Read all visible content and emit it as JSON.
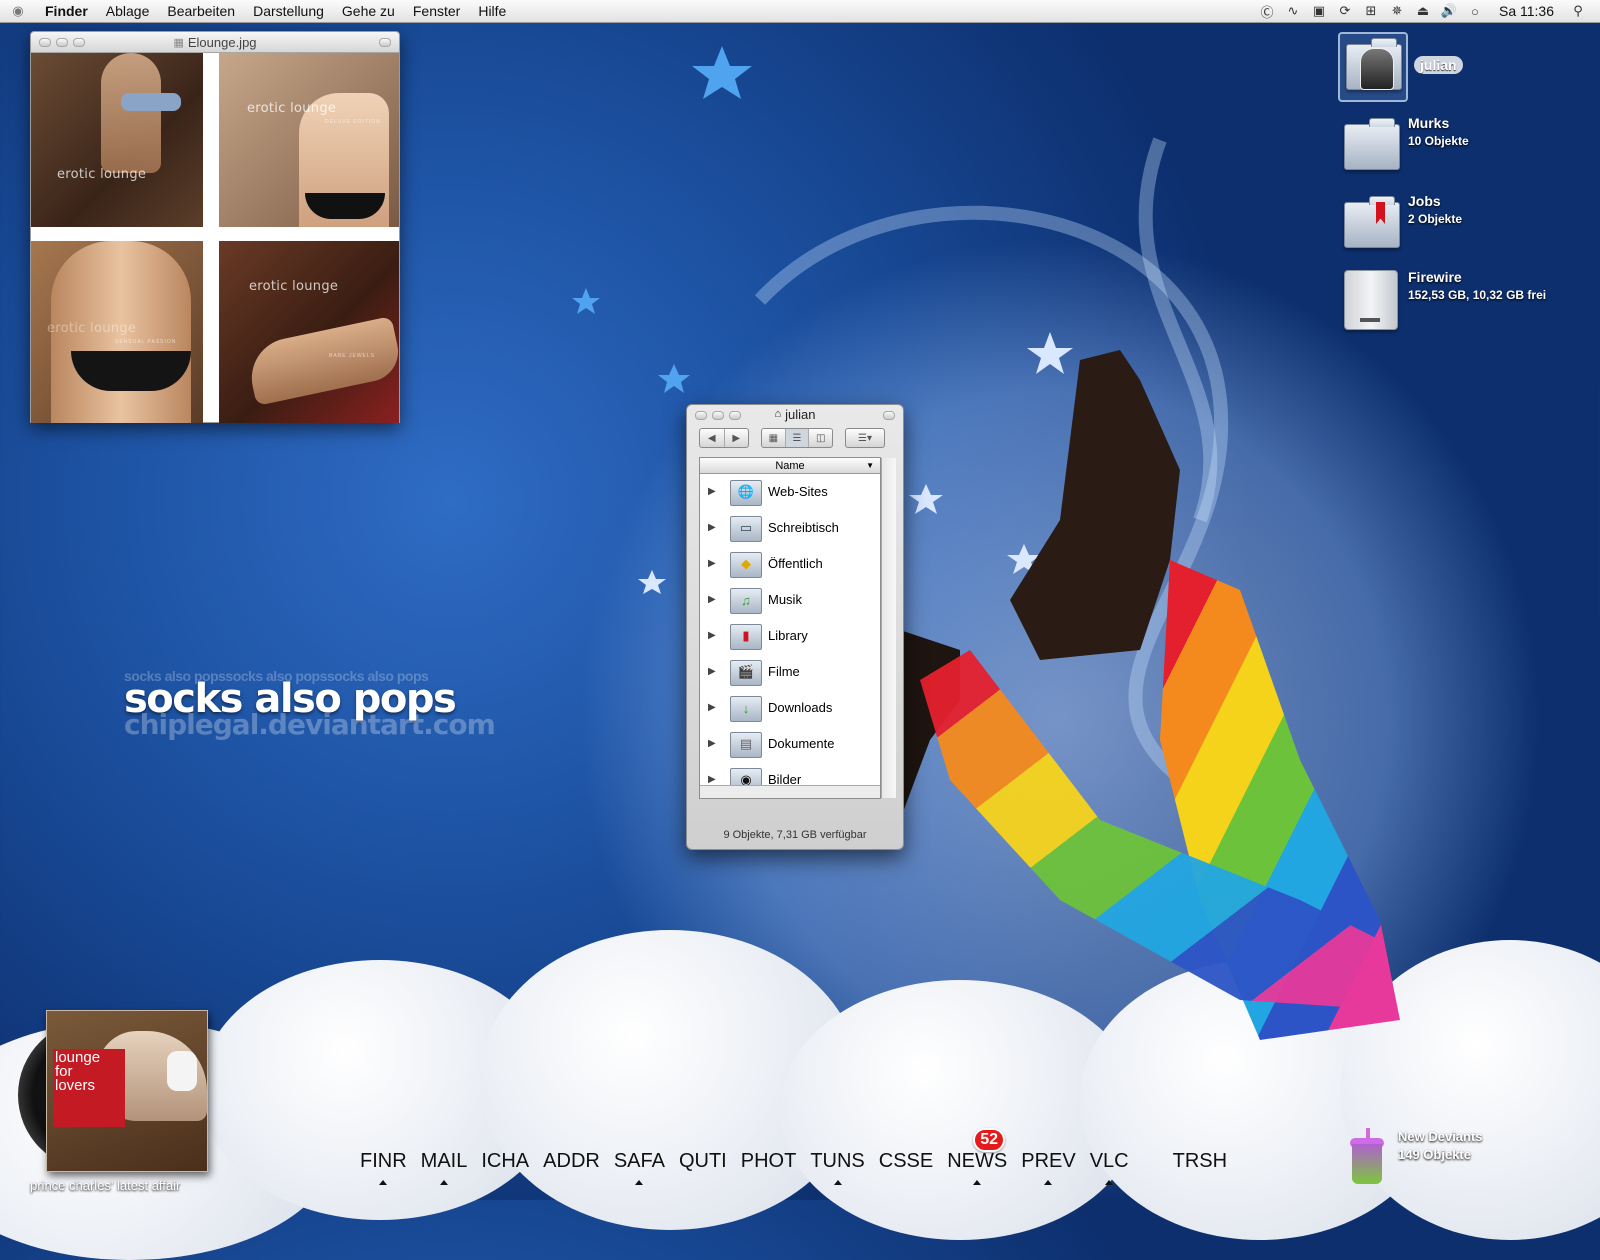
{
  "menubar": {
    "app_name": "Finder",
    "menus": [
      "Ablage",
      "Bearbeiten",
      "Darstellung",
      "Gehe zu",
      "Fenster",
      "Hilfe"
    ],
    "clock": "Sa 11:36"
  },
  "preview_window": {
    "title": "Elounge.jpg",
    "tiles": [
      {
        "label": "erotic lounge",
        "sub": ""
      },
      {
        "label": "erotic lounge",
        "sub": "DELUXE EDITION"
      },
      {
        "label": "erotic lounge",
        "sub": "SENSUAL PASSION"
      },
      {
        "label": "erotic lounge",
        "sub": "BARE JEWELS"
      }
    ]
  },
  "desktop_icons": [
    {
      "name": "julian"
    },
    {
      "name": "Murks",
      "info": "10 Objekte"
    },
    {
      "name": "Jobs",
      "info": "2 Objekte"
    },
    {
      "name": "Firewire",
      "info": "152,53 GB, 10,32 GB frei"
    }
  ],
  "wallpaper": {
    "headline": "socks also pops",
    "ghost": "socks also popssocks also popssocks also pops",
    "url": "chiplegal.deviantart.com"
  },
  "finder_window": {
    "title": "julian",
    "column_header": "Name",
    "items": [
      {
        "label": "Web-Sites",
        "icon": "globe-icon",
        "glyph": "🌐"
      },
      {
        "label": "Schreibtisch",
        "icon": "desktop-icon",
        "glyph": "▭"
      },
      {
        "label": "Öffentlich",
        "icon": "public-icon",
        "glyph": "◆"
      },
      {
        "label": "Musik",
        "icon": "music-icon",
        "glyph": "♫"
      },
      {
        "label": "Library",
        "icon": "library-icon",
        "glyph": "▮"
      },
      {
        "label": "Filme",
        "icon": "movies-icon",
        "glyph": "🎬"
      },
      {
        "label": "Downloads",
        "icon": "downloads-icon",
        "glyph": "↓"
      },
      {
        "label": "Dokumente",
        "icon": "documents-icon",
        "glyph": "▤"
      },
      {
        "label": "Bilder",
        "icon": "pictures-icon",
        "glyph": "◉"
      }
    ],
    "status": "9 Objekte, 7,31 GB verfügbar"
  },
  "dock": {
    "items": [
      {
        "label": "FINR",
        "running": true
      },
      {
        "label": "MAIL",
        "running": true
      },
      {
        "label": "ICHA",
        "running": false
      },
      {
        "label": "ADDR",
        "running": false
      },
      {
        "label": "SAFA",
        "running": true
      },
      {
        "label": "QUTI",
        "running": false
      },
      {
        "label": "PHOT",
        "running": false
      },
      {
        "label": "TUNS",
        "running": true
      },
      {
        "label": "CSSE",
        "running": false
      },
      {
        "label": "NEWS",
        "running": true,
        "badge": "52"
      },
      {
        "label": "PREV",
        "running": true
      },
      {
        "label": "VLC",
        "running": true
      },
      {
        "label": "TRSH",
        "running": false
      }
    ]
  },
  "now_playing": {
    "album_line1": "lounge",
    "album_line2": "for",
    "album_line3": "lovers",
    "caption": "prince charles' latest affair"
  },
  "deviant_widget": {
    "title": "New Deviants",
    "info": "149 Objekte"
  }
}
